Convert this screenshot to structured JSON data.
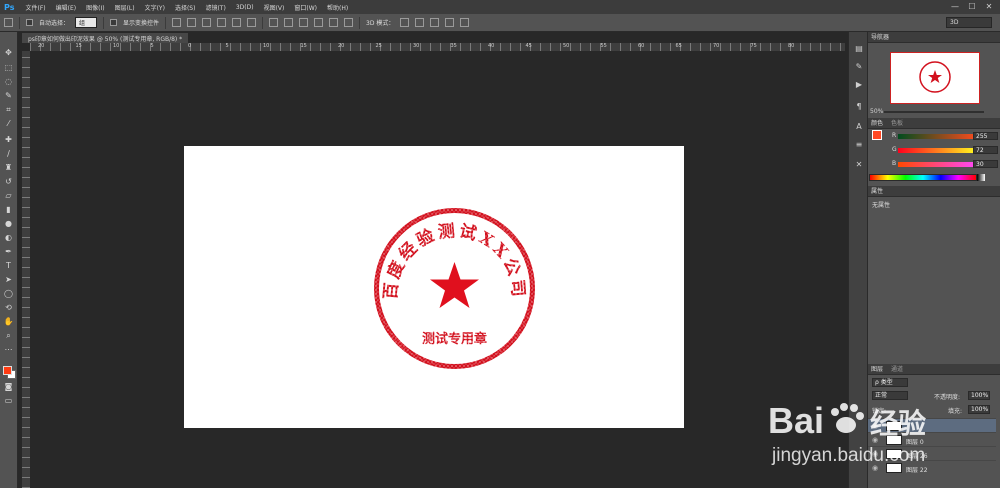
{
  "app": {
    "logo": "Ps"
  },
  "menu": [
    "文件(F)",
    "编辑(E)",
    "图像(I)",
    "图层(L)",
    "文字(Y)",
    "选择(S)",
    "滤镜(T)",
    "3D(D)",
    "视图(V)",
    "窗口(W)",
    "帮助(H)"
  ],
  "window_controls": [
    "—",
    "☐",
    "✕"
  ],
  "options": {
    "auto_select_label": "自动选择：",
    "auto_select_value": "组",
    "show_transform_label": "显示变换控件",
    "mode_3d_label": "3D 模式：",
    "workspace": "3D"
  },
  "document": {
    "tab_title": "ps印章如何做出印泥效果 @ 50% (测试专用章, RGB/8) *",
    "ruler_labels": [
      "20",
      "15",
      "10",
      "5",
      "0",
      "5",
      "10",
      "15",
      "20",
      "25",
      "30",
      "35",
      "40",
      "45",
      "50",
      "55",
      "60",
      "65",
      "70",
      "75",
      "80"
    ]
  },
  "stamp": {
    "arc_text": "百度经验测试XX公司",
    "center_text": "测试专用章",
    "color": "#d2101d"
  },
  "panels": {
    "navigator_tab": "导航器",
    "navigator_zoom": "50%",
    "color_tab": "颜色",
    "swatches_tab": "色板",
    "color_r_label": "R",
    "color_g_label": "G",
    "color_b_label": "B",
    "color_r": "255",
    "color_g": "72",
    "color_b": "30",
    "properties_tab": "属性",
    "properties_empty": "无属性",
    "layers_tab": "图层",
    "channels_tab": "通道",
    "kind_filter": "ρ 类型",
    "blend_mode": "正常",
    "opacity_label": "不透明度:",
    "opacity_value": "100%",
    "lock_label": "锁定:",
    "fill_label": "填充:",
    "fill_value": "100%",
    "layers": [
      "图层 0",
      "图层 26",
      "图层 22"
    ]
  },
  "watermark": {
    "brand": "Bai",
    "brand_suffix": "经验",
    "url": "jingyan.baidu.com"
  }
}
